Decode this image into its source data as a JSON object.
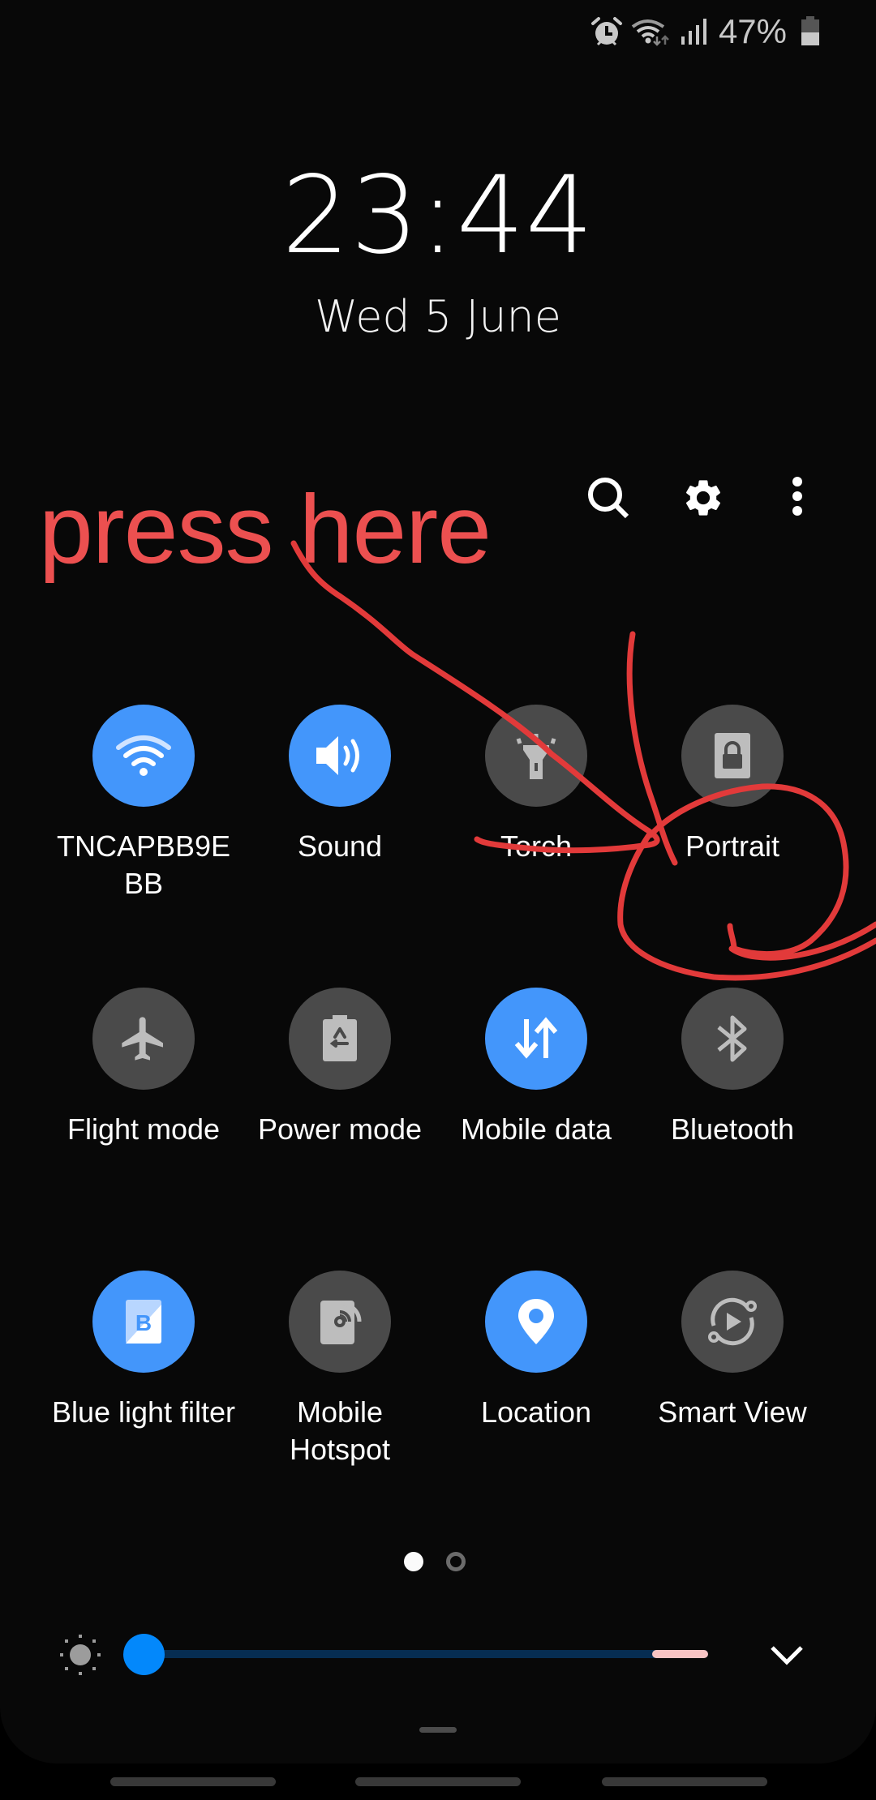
{
  "status_bar": {
    "icons": [
      "alarm-icon",
      "wifi-data-icon",
      "signal-icon",
      "battery-icon"
    ],
    "battery_percent": "47%"
  },
  "lock": {
    "time": "23:44",
    "date": "Wed 5 June"
  },
  "header_actions": [
    {
      "name": "search",
      "icon": "search-icon"
    },
    {
      "name": "settings",
      "icon": "gear-icon"
    },
    {
      "name": "more-options",
      "icon": "more-vertical-icon"
    }
  ],
  "annotation": {
    "text": "press here",
    "color": "#ec5050",
    "target": "Portrait"
  },
  "tiles": [
    {
      "label": "TNCAPBB9E BB",
      "icon": "wifi-icon",
      "on": true
    },
    {
      "label": "Sound",
      "icon": "speaker-icon",
      "on": true
    },
    {
      "label": "Torch",
      "icon": "flashlight-icon",
      "on": false
    },
    {
      "label": "Portrait",
      "icon": "rotation-lock-icon",
      "on": false
    },
    {
      "label": "Flight mode",
      "icon": "airplane-icon",
      "on": false
    },
    {
      "label": "Power mode",
      "icon": "battery-recycle-icon",
      "on": false
    },
    {
      "label": "Mobile data",
      "icon": "data-arrows-icon",
      "on": true
    },
    {
      "label": "Bluetooth",
      "icon": "bluetooth-icon",
      "on": false
    },
    {
      "label": "Blue light filter",
      "icon": "blue-light-icon",
      "on": true
    },
    {
      "label": "Mobile Hotspot",
      "icon": "hotspot-icon",
      "on": false
    },
    {
      "label": "Location",
      "icon": "location-pin-icon",
      "on": true
    },
    {
      "label": "Smart View",
      "icon": "smart-view-icon",
      "on": false
    }
  ],
  "pager": {
    "pages": 2,
    "current": 1
  },
  "brightness": {
    "level": 0.0,
    "icon": "sun-icon"
  },
  "colors": {
    "accent_on": "#4396fb",
    "tile_off": "#4a4a4a",
    "slider_thumb": "#0388fb",
    "slider_track": "#062d52",
    "slider_extra": "#f8c4c4"
  }
}
